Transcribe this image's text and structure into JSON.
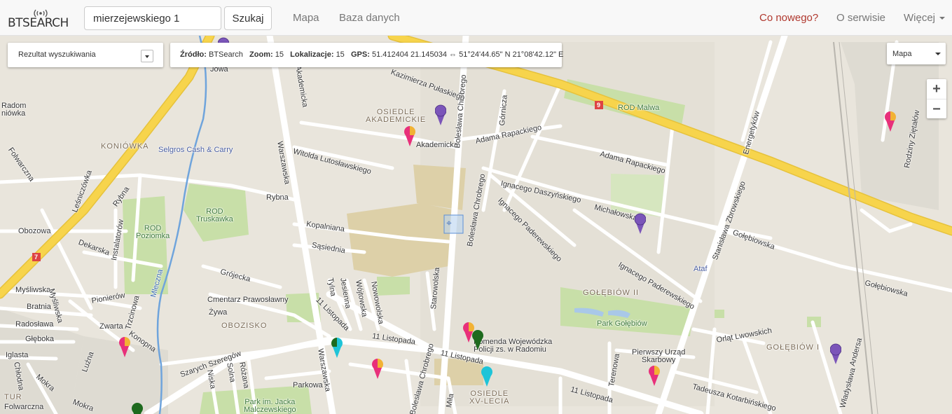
{
  "navbar": {
    "logo": "BTSEARCH",
    "search_value": "mierzejewskiego 1",
    "search_button": "Szukaj",
    "links": [
      "Mapa",
      "Baza danych"
    ],
    "right_links": {
      "news": "Co nowego?",
      "about": "O serwisie",
      "more": "Więcej"
    }
  },
  "controls": {
    "result_dropdown": "Rezultat wyszukiwania",
    "info": {
      "source_label": "Źródło:",
      "source_value": "BTSearch",
      "zoom_label": "Zoom:",
      "zoom_value": "15",
      "locations_label": "Lokalizacje:",
      "locations_value": "15",
      "gps_label": "GPS:",
      "gps_value": "51.412404 21.145034 ⇔ 51°24'44.65\" N 21°08'42.12\" E"
    },
    "map_type": "Mapa",
    "zoom_in": "+",
    "zoom_out": "−"
  },
  "map_labels": {
    "radom_koniowka": "Radom\nniówka",
    "koniowka": "KONIÓWKA",
    "selgros": "Selgros Cash & Carry",
    "folwarczna": "Folwarczna",
    "obozowa": "Obozowa",
    "lesniczowka": "Leśniczówka",
    "dekarska": "Dekarska",
    "instalatorow": "Instalatorów",
    "rybna1": "Rybna",
    "rybna2": "Rybna",
    "rod_poziomka": "ROD\nPoziomka",
    "rod_truskawka": "ROD\nTruskawka",
    "mysliwska1": "Myśliwska",
    "mysliwska2": "Myśliwska",
    "brataia": "Bratnia",
    "radoslawa": "Radosława",
    "glebokaa": "Głęboka",
    "iglasta": "Iglasta",
    "chlodna": "Chłodna",
    "lużna": "Luźna",
    "mokra1": "Mokra",
    "mokra2": "Mokra",
    "tur": "TUR",
    "folwarczna2": "Folwarczna",
    "pionierow": "Pionierów",
    "zwarta": "Zwarta",
    "trzcinowa": "Trzcinowa",
    "konopna": "Konopna",
    "mleczna": "Mleczna",
    "grojecka": "Grójecka",
    "cmentarz": "Cmentarz Prawosławny",
    "zywa": "Żywa",
    "obozisko": "OBOZISKO",
    "szarych": "Szarych Szeregów",
    "niska": "Niska",
    "solna": "Solna",
    "rozana": "Różana",
    "parkowa": "Parkowa",
    "park_jacka": "Park im. Jacka\nMalczewskiego",
    "warszawska1": "Warszawska",
    "warszawska2": "Warszawska",
    "akademicka1": "Akademicka",
    "akademicka2": "Akademicka",
    "lutoslawskiego": "Witolda Lutosławskiego",
    "kopalniana": "Kopalniana",
    "sasiednia": "Sąsiednia",
    "tylna": "Tylna",
    "jesienna": "Jesienna",
    "wojtowska": "Wójtowska",
    "nowowolska": "Nowowolska",
    "listopada1": "11 Listopada",
    "listopada2": "11 Listopada",
    "listopada3": "11 Listopada",
    "listopada4": "11 Listopada",
    "starowolska": "Starowolska",
    "chrobrego1": "Bolesława Chrobrego",
    "chrobrego2": "Bolesława Chrobrego",
    "chrobrego3": "Bolesława Chrobrego",
    "osiedle_akad": "OSIEDLE\nAKADEMICKIE",
    "pulaskiego": "Kazimierza Pułaskiego",
    "jowa": "Jowa",
    "gornicza": "Górnicza",
    "rapackiego1": "Adama Rapackiego",
    "rapackiego2": "Adama Rapackiego",
    "rod_malwa": "ROD Malwa",
    "daszynskiego": "Ignacego Daszyńskiego",
    "paderewskiego1": "Ignacego Paderewskiego",
    "paderewskiego2": "Ignacego Paderewskiego",
    "michalowska": "Michałowska",
    "energetykow": "Energetyków",
    "zbrowskiego": "Stanisława Zbrowskiego",
    "golebiowska1": "Gołębiowska",
    "golebiowska2": "Gołębiowska",
    "ataf": "Ataf",
    "golebiow2": "GOŁĘBIÓW II",
    "park_golebiow": "Park Gołębiów",
    "orlat": "Orląt Lwowskich",
    "pierwszy_urzad": "Pierwszy Urząd\nSkarbowy",
    "golebiow1": "GOŁĘBIÓW I",
    "tadeusza": "Tadeusza Kotarbińskiego",
    "komenda": "Komenda Wojewódzka\nPolicji zs. w Radomiu",
    "osiedle_xv": "OSIEDLE\nXV-LECIA",
    "mila": "Miła",
    "terenowa": "Terenowa",
    "rodziny": "Rodziny Ziętałów",
    "andersa": "Andersa",
    "wladyslawa": "Władysława"
  },
  "colors": {
    "road_major": "#f7d44c",
    "park": "#c8dfa8",
    "campus": "#ddd0a8",
    "water": "#a9c8e8",
    "pin_purple": "#7b55b9",
    "pin_green": "#1e6a1e",
    "pin_cyan": "#1ec4d8",
    "pin_pink": "#e8307a",
    "pin_orange": "#f2b234"
  }
}
